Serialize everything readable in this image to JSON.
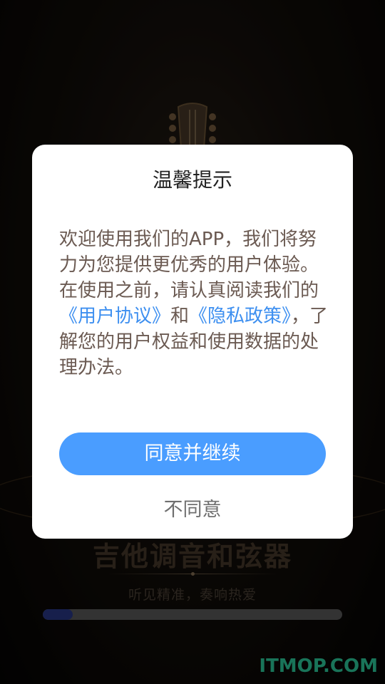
{
  "splash": {
    "app_title": "吉他调音和弦器",
    "slogan": "听见精准，奏响热爱",
    "loading_progress": 0.1
  },
  "dialog": {
    "title": "温馨提示",
    "body_intro": "欢迎使用我们的APP，我们将努力为您提供更优秀的用户体验。在使用之前，请认真阅读我们的",
    "user_agreement_link": "《用户协议》",
    "and_text": "和",
    "privacy_policy_link": "《隐私政策》",
    "body_outro": "，了解您的用户权益和使用数据的处理办法。",
    "agree_label": "同意并继续",
    "disagree_label": "不同意"
  },
  "watermark": "ITMOP.COM",
  "colors": {
    "accent": "#4a9dff",
    "link": "#3d8ff0",
    "watermark": "#2ed3a2",
    "progress": "#2a3a8a"
  }
}
